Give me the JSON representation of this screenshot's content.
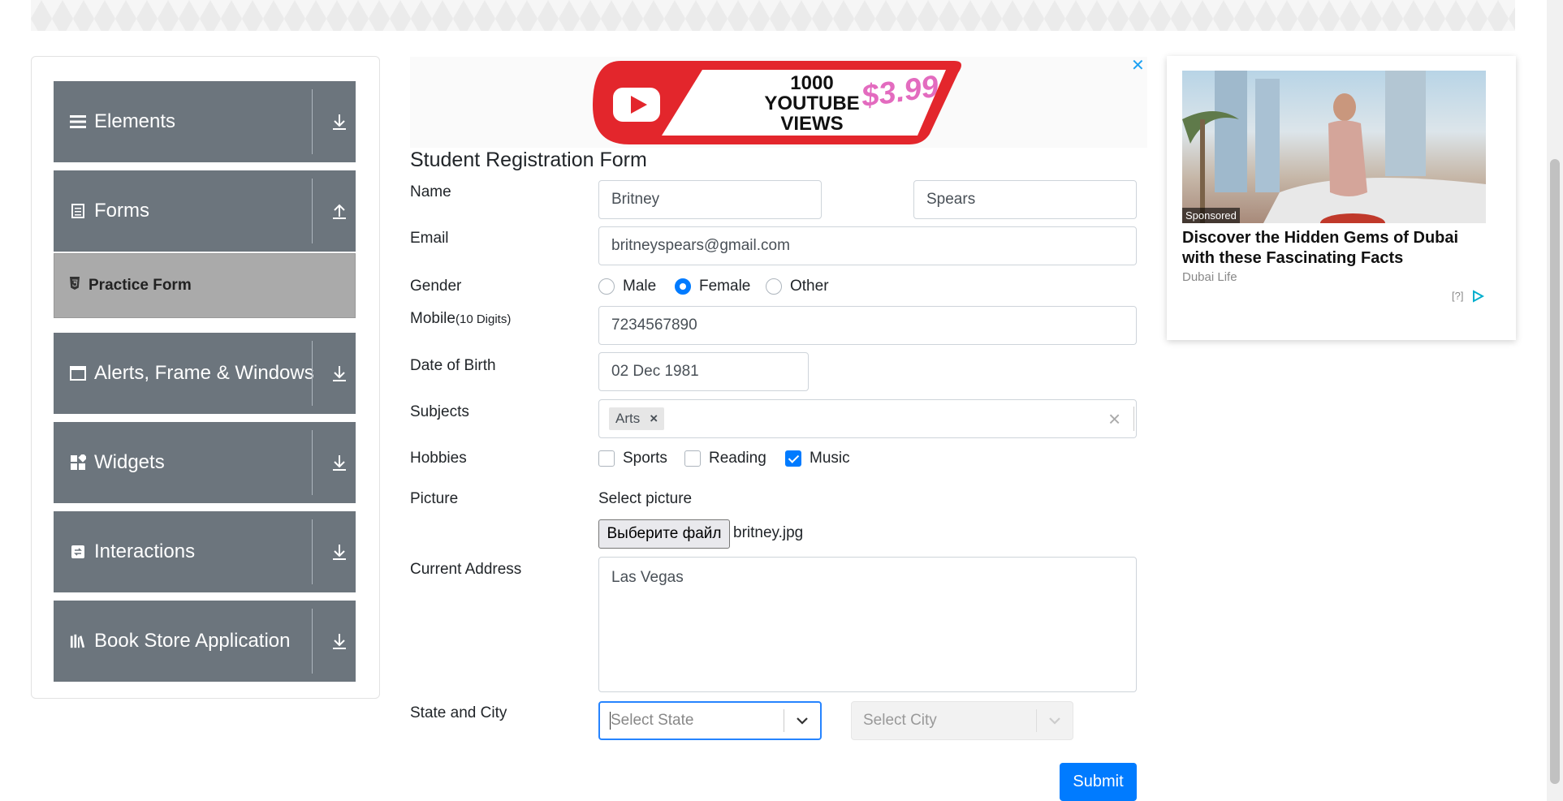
{
  "sidebar": {
    "groups": [
      {
        "label": "Elements",
        "icon": "menu-icon",
        "arrow": "download-arrow-icon"
      },
      {
        "label": "Forms",
        "icon": "document-icon",
        "arrow": "upload-arrow-icon"
      },
      {
        "label": "Alerts, Frame & Windows",
        "icon": "window-icon",
        "arrow": "download-arrow-icon"
      },
      {
        "label": "Widgets",
        "icon": "widgets-icon",
        "arrow": "download-arrow-icon"
      },
      {
        "label": "Interactions",
        "icon": "interactions-icon",
        "arrow": "download-arrow-icon"
      },
      {
        "label": "Book Store Application",
        "icon": "books-icon",
        "arrow": "download-arrow-icon"
      }
    ],
    "active_item": {
      "label": "Practice Form",
      "icon": "html5-icon"
    }
  },
  "ad_banner": {
    "line1": "1000",
    "line2": "YOUTUBE VIEWS",
    "price": "$3.99",
    "close": "✕"
  },
  "form": {
    "title": "Student Registration Form",
    "name_label": "Name",
    "first_name": "Britney",
    "last_name": "Spears",
    "email_label": "Email",
    "email": "britneyspears@gmail.com",
    "gender_label": "Gender",
    "gender_options": [
      "Male",
      "Female",
      "Other"
    ],
    "gender_selected": "Female",
    "mobile_label": "Mobile",
    "mobile_hint": "(10 Digits)",
    "mobile": "7234567890",
    "dob_label": "Date of Birth",
    "dob": "02 Dec 1981",
    "subjects_label": "Subjects",
    "subject_chip": "Arts",
    "chip_remove": "×",
    "clear_all": "×",
    "hobbies_label": "Hobbies",
    "hobbies": [
      "Sports",
      "Reading",
      "Music"
    ],
    "hobbies_checked": [
      "Music"
    ],
    "picture_label": "Picture",
    "picture_caption": "Select picture",
    "file_button": "Выберите файл",
    "file_name": "britney.jpg",
    "address_label": "Current Address",
    "address": "Las Vegas",
    "state_city_label": "State and City",
    "state_placeholder": "Select State",
    "city_placeholder": "Select City",
    "submit": "Submit"
  },
  "side_ad": {
    "badge": "Sponsored",
    "headline": "Discover the Hidden Gems of Dubai with these Fascinating Facts",
    "source": "Dubai Life",
    "info": "[?]"
  },
  "colors": {
    "sidebar_group": "#6c757d",
    "active_item": "#aaaaaa",
    "accent": "#007bff"
  }
}
